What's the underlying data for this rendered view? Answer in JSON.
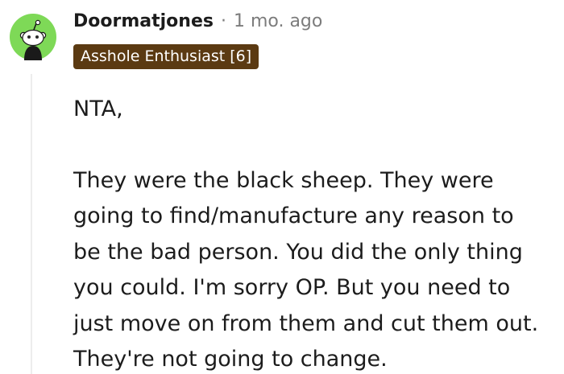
{
  "comment": {
    "author": "Doormatjones",
    "separator": "·",
    "timestamp": "1 mo. ago",
    "flair": "Asshole Enthusiast [6]",
    "flair_color": "#5b3a12",
    "avatar_icon": "snoo-avatar-icon",
    "avatar_color": "#7ed957",
    "paragraphs": [
      "NTA,",
      "They were the black sheep. They were\ngoing to find/manufacture any reason to\nbe the bad person. You did the only thing\nyou could. I'm sorry OP. But you need to\njust move on from them and cut them out.\nThey're not going to change."
    ]
  }
}
